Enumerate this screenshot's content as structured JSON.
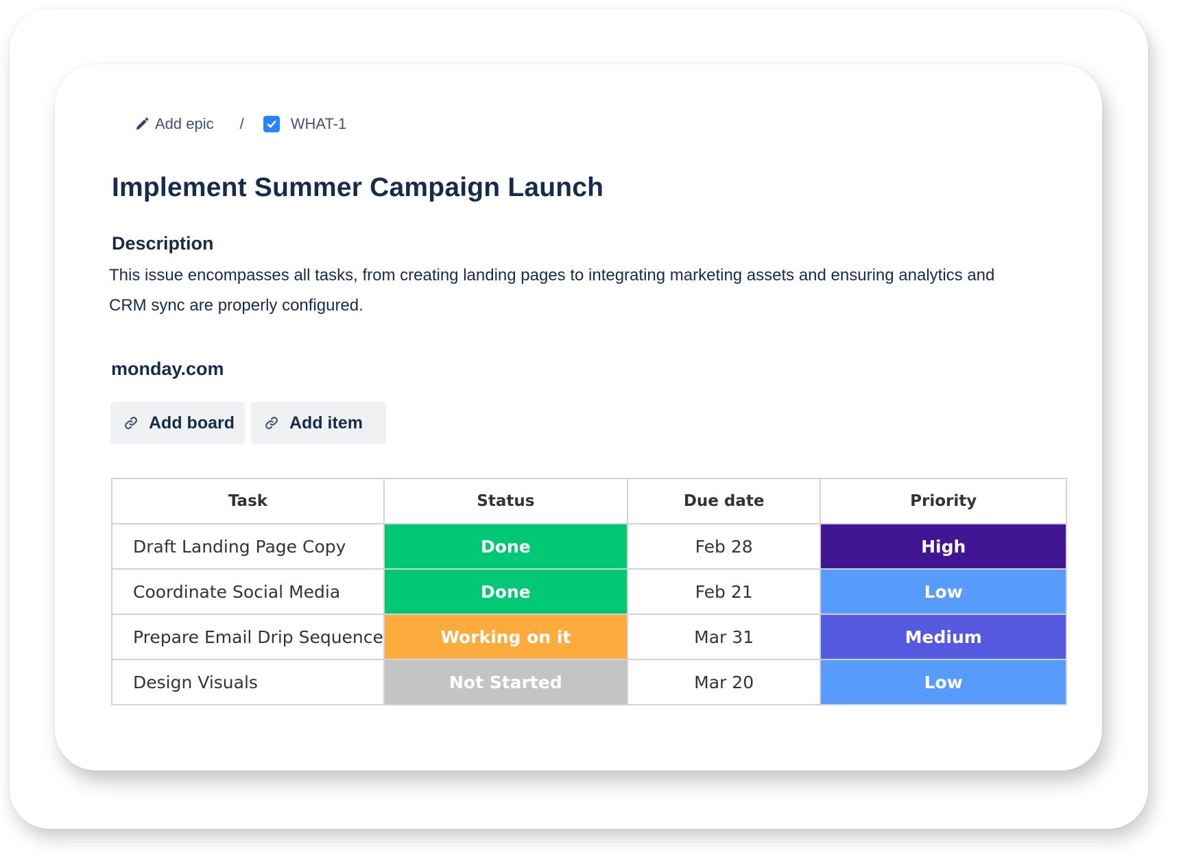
{
  "breadcrumb": {
    "epic_label": "Add epic",
    "separator": "/",
    "issue_key": "WHAT-1"
  },
  "issue": {
    "title": "Implement Summer Campaign Launch",
    "description_heading": "Description",
    "description": "This issue encompasses all tasks, from creating landing pages to integrating marketing assets and ensuring analytics and CRM sync are properly configured."
  },
  "integration": {
    "heading": "monday.com",
    "add_board_label": "Add board",
    "add_item_label": "Add item"
  },
  "table": {
    "columns": [
      "Task",
      "Status",
      "Due date",
      "Priority"
    ],
    "rows": [
      {
        "task": "Draft Landing Page Copy",
        "status": "Done",
        "status_color": "#00c875",
        "due": "Feb 28",
        "priority": "High",
        "priority_color": "#401694"
      },
      {
        "task": "Coordinate Social Media",
        "status": "Done",
        "status_color": "#00c875",
        "due": "Feb 21",
        "priority": "Low",
        "priority_color": "#579bfc"
      },
      {
        "task": "Prepare Email Drip Sequence",
        "status": "Working on it",
        "status_color": "#fdab3d",
        "due": "Mar 31",
        "priority": "Medium",
        "priority_color": "#5559df"
      },
      {
        "task": "Design Visuals",
        "status": "Not Started",
        "status_color": "#c4c4c4",
        "due": "Mar 20",
        "priority": "Low",
        "priority_color": "#579bfc"
      }
    ]
  },
  "icons": {
    "epic": "pencil-icon",
    "issue_type": "checkbox-icon",
    "link": "link-icon"
  }
}
